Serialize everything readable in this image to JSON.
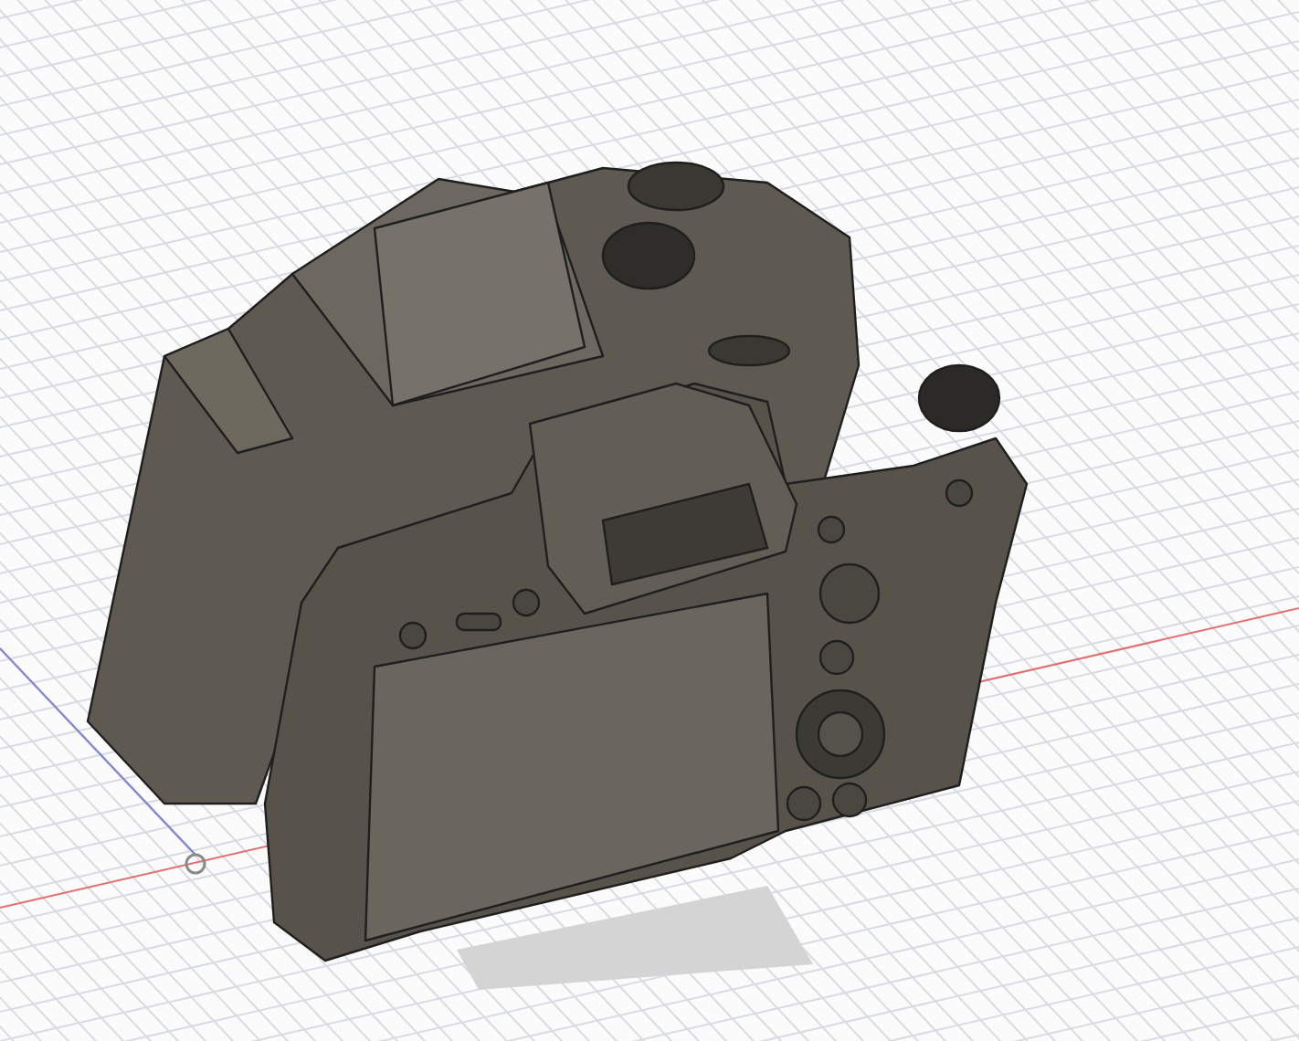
{
  "viewport": {
    "show_grid": true,
    "show_origin": true
  }
}
